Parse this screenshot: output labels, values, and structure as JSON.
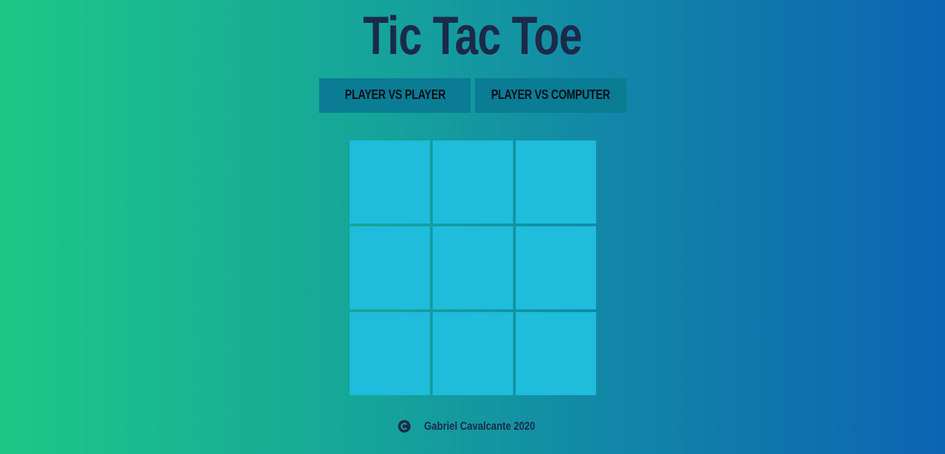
{
  "title": "Tic Tac Toe",
  "modes": [
    {
      "label": "PLAYER VS PLAYER"
    },
    {
      "label": "PLAYER VS COMPUTER"
    }
  ],
  "board": {
    "cells": [
      "",
      "",
      "",
      "",
      "",
      "",
      "",
      "",
      ""
    ]
  },
  "footer": {
    "icon": "copyright-icon",
    "text": "Gabriel Cavalcante 2020"
  },
  "colors": {
    "gradient_start": "#1ec787",
    "gradient_end": "#0c64b2",
    "title": "#1b2a4a",
    "mode_button": "#0a7c94",
    "cell": "#1fbcdb"
  }
}
